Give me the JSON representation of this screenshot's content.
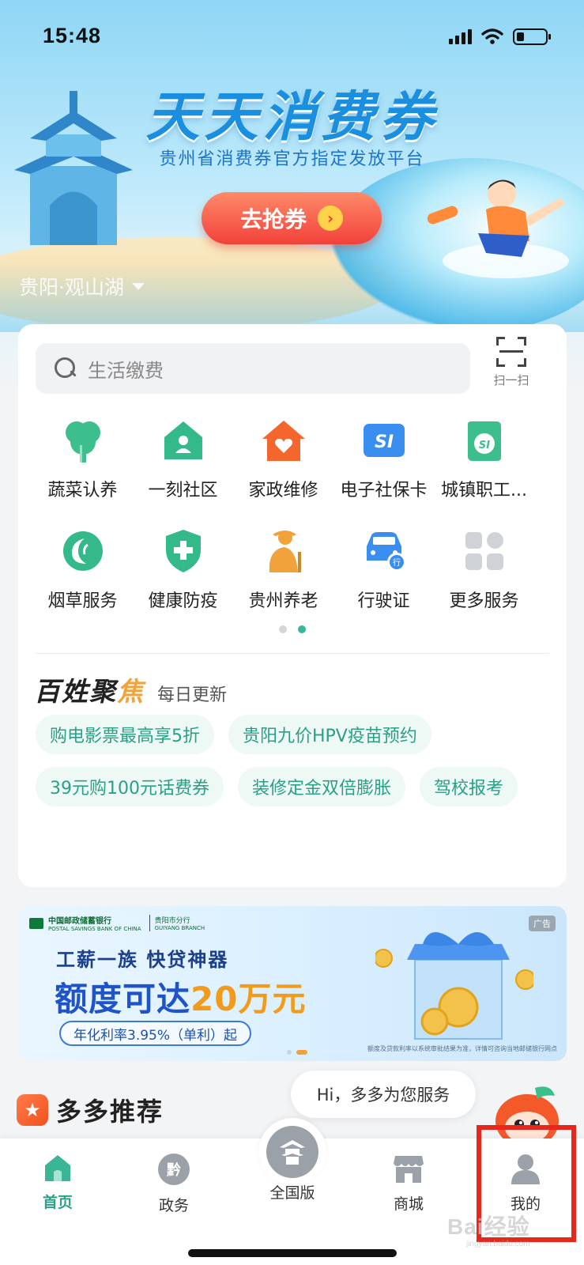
{
  "status_bar": {
    "time": "15:48",
    "battery_level": 0.25
  },
  "hero": {
    "title": "天天消费券",
    "subtitle": "贵州省消费券官方指定发放平台",
    "cta_label": "去抢券",
    "location": "贵阳·观山湖"
  },
  "search": {
    "placeholder": "生活缴费",
    "scan_label": "扫一扫"
  },
  "services": [
    {
      "label": "蔬菜认养",
      "icon": "tree-icon",
      "color": "#3cbf8d"
    },
    {
      "label": "一刻社区",
      "icon": "community-icon",
      "color": "#34b98b"
    },
    {
      "label": "家政维修",
      "icon": "house-heart-icon",
      "color": "#f3672f"
    },
    {
      "label": "电子社保卡",
      "icon": "social-security-card-icon",
      "color": "#3a8ef0"
    },
    {
      "label": "城镇职工...",
      "icon": "insurance-icon",
      "color": "#3cbf8d"
    },
    {
      "label": "烟草服务",
      "icon": "tobacco-icon",
      "color": "#34b98b"
    },
    {
      "label": "健康防疫",
      "icon": "health-shield-icon",
      "color": "#34b98b"
    },
    {
      "label": "贵州养老",
      "icon": "elderly-icon",
      "color": "#f2a23b"
    },
    {
      "label": "行驶证",
      "icon": "car-license-icon",
      "color": "#3a8ef0"
    },
    {
      "label": "更多服务",
      "icon": "more-grid-icon",
      "color": "#cfd3d7"
    }
  ],
  "focus": {
    "title_main": "百姓聚",
    "title_accent": "焦",
    "subtitle": "每日更新",
    "tags": [
      "购电影票最高享5折",
      "贵阳九价HPV疫苗预约",
      "39元购100元话费券",
      "装修定金双倍膨胀",
      "驾校报考"
    ]
  },
  "ad": {
    "bank_name": "中国邮政储蓄银行",
    "bank_name_en": "POSTAL SAVINGS BANK OF CHINA",
    "branch": "贵阳市分行",
    "branch_en": "GUIYANG BRANCH",
    "badge": "广告",
    "line1": "工薪一族  快贷神器",
    "line2_prefix": "额度可达",
    "line2_highlight": "20万元",
    "rate": "年化利率3.95%（单利）起",
    "fine_print": "额度及贷款利率以系统审批结果为准，详情可咨询当地邮储银行网点"
  },
  "recommend": {
    "title": "多多推荐",
    "chat_text": "Hi，多多为您服务"
  },
  "tab_bar": {
    "tabs": [
      {
        "label": "首页",
        "icon": "home-icon",
        "active": true
      },
      {
        "label": "政务",
        "icon": "government-icon",
        "active": false
      },
      {
        "label": "全国版",
        "icon": "pavilion-icon",
        "active": false
      },
      {
        "label": "商城",
        "icon": "shop-icon",
        "active": false
      },
      {
        "label": "我的",
        "icon": "profile-icon",
        "active": false
      }
    ]
  },
  "watermark": {
    "text": "Bai经验",
    "sub": "jingyan.baidu.com"
  },
  "colors": {
    "accent": "#2aa086",
    "highlight_box": "#e8261c",
    "cta": "#f2413a"
  }
}
